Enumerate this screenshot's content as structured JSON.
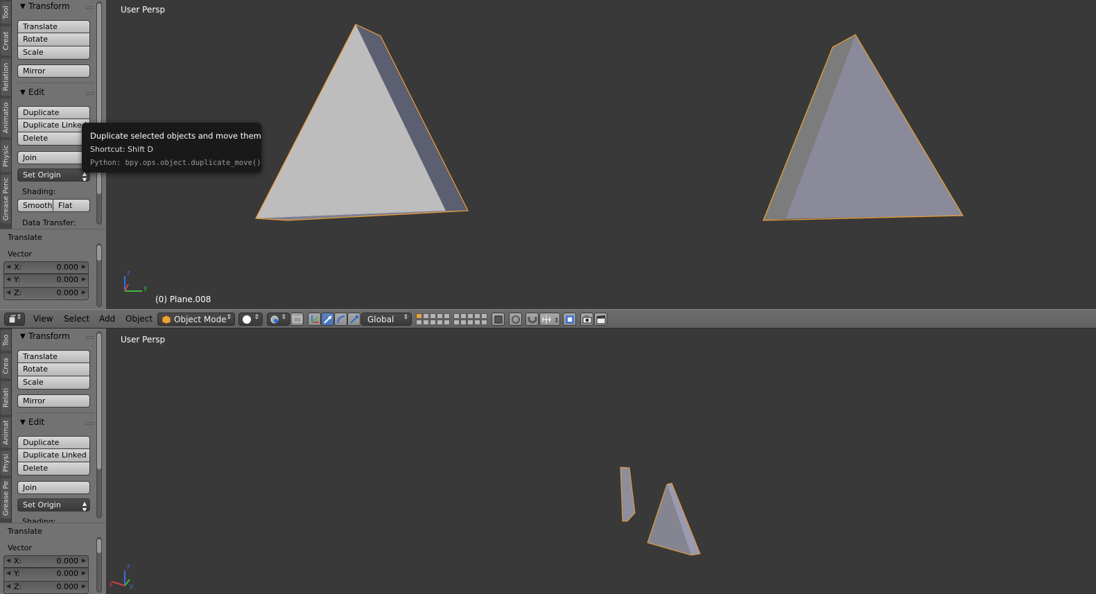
{
  "top": {
    "tabs": [
      "Tool",
      "Creat",
      "Relation",
      "Animatio",
      "Physic",
      "Grease Penc"
    ],
    "transform_title": "Transform",
    "transform_buttons": [
      "Translate",
      "Rotate",
      "Scale"
    ],
    "mirror": "Mirror",
    "edit_title": "Edit",
    "edit_buttons": [
      "Duplicate",
      "Duplicate Linked",
      "Delete"
    ],
    "join": "Join",
    "set_origin": "Set Origin",
    "shading_label": "Shading:",
    "smooth": "Smooth",
    "flat": "Flat",
    "data_transfer": "Data Transfer:",
    "op_title": "Translate",
    "vector_label": "Vector",
    "vector": [
      {
        "axis": "X:",
        "value": "0.000"
      },
      {
        "axis": "Y:",
        "value": "0.000"
      },
      {
        "axis": "Z:",
        "value": "0.000"
      }
    ],
    "view_label": "User Persp",
    "object_label": "(0) Plane.008"
  },
  "header": {
    "menus": [
      "View",
      "Select",
      "Add",
      "Object"
    ],
    "mode": "Object Mode",
    "orientation": "Global"
  },
  "bottom": {
    "tabs": [
      "Too",
      "Crea",
      "Relati",
      "Animat",
      "Physi",
      "Grease Pe"
    ],
    "transform_title": "Transform",
    "transform_buttons": [
      "Translate",
      "Rotate",
      "Scale"
    ],
    "mirror": "Mirror",
    "edit_title": "Edit",
    "edit_buttons": [
      "Duplicate",
      "Duplicate Linked",
      "Delete"
    ],
    "join": "Join",
    "set_origin": "Set Origin",
    "shading_label": "Shading:",
    "op_title": "Translate",
    "vector_label": "Vector",
    "vector": [
      {
        "axis": "X:",
        "value": "0.000"
      },
      {
        "axis": "Y:",
        "value": "0.000"
      },
      {
        "axis": "Z:",
        "value": "0.000"
      }
    ],
    "view_label": "User Persp"
  },
  "tooltip": {
    "title": "Duplicate selected objects and move them",
    "shortcut": "Shortcut: Shift D",
    "python": "Python: bpy.ops.object.duplicate_move()"
  },
  "axes": {
    "x": "x",
    "y": "y",
    "z": "z"
  },
  "colors": {
    "background": "#393939",
    "panel": "#727272",
    "selection_outline": "#f0a030",
    "active_button": "#4672b8"
  }
}
